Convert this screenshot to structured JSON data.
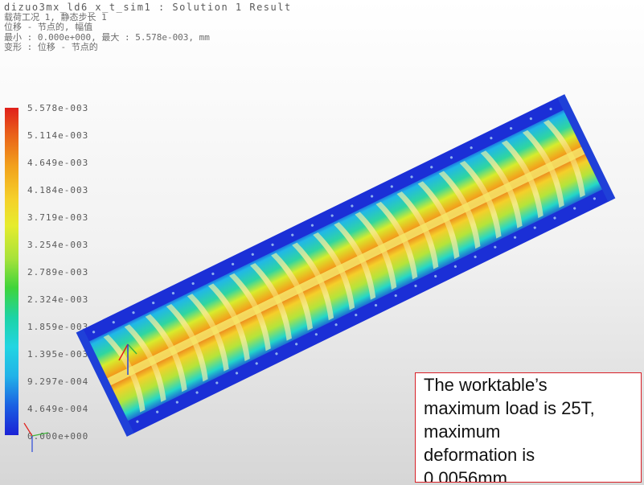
{
  "header": {
    "line0": "dizuo3mx_ld6_x_t_sim1 : Solution 1 Result",
    "line1": "载荷工况 1, 静态步长 1",
    "line2": "位移 - 节点的, 幅值",
    "line3": "最小 : 0.000e+000, 最大 : 5.578e-003, mm",
    "line4": "变形 : 位移 - 节点的"
  },
  "legend": {
    "labels": [
      "5.578e-003",
      "5.114e-003",
      "4.649e-003",
      "4.184e-003",
      "3.719e-003",
      "3.254e-003",
      "2.789e-003",
      "2.324e-003",
      "1.859e-003",
      "1.395e-003",
      "9.297e-004",
      "4.649e-004",
      "0.000e+000"
    ],
    "max_color": "#e0201b",
    "min_color": "#1b22d6"
  },
  "note": {
    "line1": "The worktable’s",
    "line2": "maximum load is 25T,",
    "line3": "maximum",
    "line4": "deformation is",
    "line5": "0.0056mm",
    "border_color": "#d81f26"
  }
}
